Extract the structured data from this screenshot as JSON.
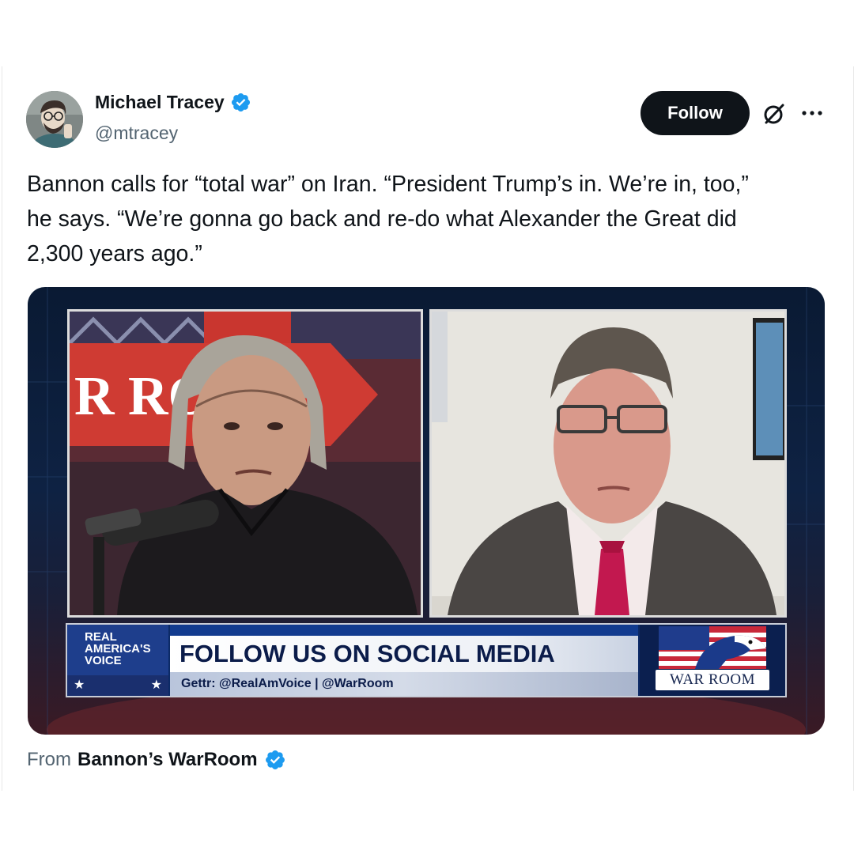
{
  "author": {
    "display_name": "Michael Tracey",
    "handle": "@mtracey",
    "verified": true
  },
  "actions": {
    "follow_label": "Follow",
    "grok_icon": "grok-icon",
    "more_icon": "more-icon"
  },
  "tweet": {
    "lines": [
      "Bannon calls for “total war” on Iran. “President Trump’s in. We’re in, too,”",
      "he says. “We’re gonna go back and re-do what Alexander the Great did",
      "2,300 years ago.”"
    ]
  },
  "media": {
    "set_sign_text": "R RO",
    "network_logo_lines": [
      "REAL",
      "AMERICA'S",
      "VOICE"
    ],
    "ticker_headline": "FOLLOW US ON SOCIAL MEDIA",
    "ticker_subline": "Gettr: @RealAmVoice | @WarRoom",
    "show_logo_text": "WAR ROOM",
    "star_glyph": "★"
  },
  "source": {
    "prefix": "From",
    "name": "Bannon’s WarRoom",
    "verified": true
  },
  "colors": {
    "verified_blue": "#1d9bf0",
    "text_primary": "#0f1419",
    "text_secondary": "#536471",
    "follow_bg": "#0f1419"
  }
}
